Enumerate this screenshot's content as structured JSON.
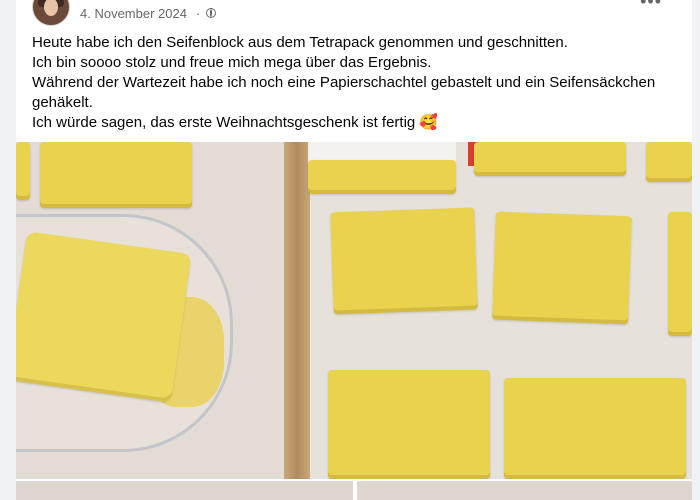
{
  "post": {
    "date": "4. November 2024",
    "separator": "·",
    "audience_icon": "globe-icon",
    "more_icon": "more-options-icon",
    "text_lines": [
      "Heute habe ich den Seifenblock aus dem Tetrapack genommen und geschnitten.",
      "Ich bin soooo stolz und freue mich mega über das Ergebnis.",
      "Während der Wartezeit habe ich noch eine Papierschachtel gebastelt und ein Seifensäckchen gehäkelt.",
      "Ich würde sagen, das erste Weihnachtsgeschenk ist fertig 🥰"
    ]
  },
  "colors": {
    "background": "#f0f2f5",
    "card": "#ffffff",
    "meta_text": "#65676b",
    "body_text": "#050505",
    "soap": "#e8d24e"
  }
}
